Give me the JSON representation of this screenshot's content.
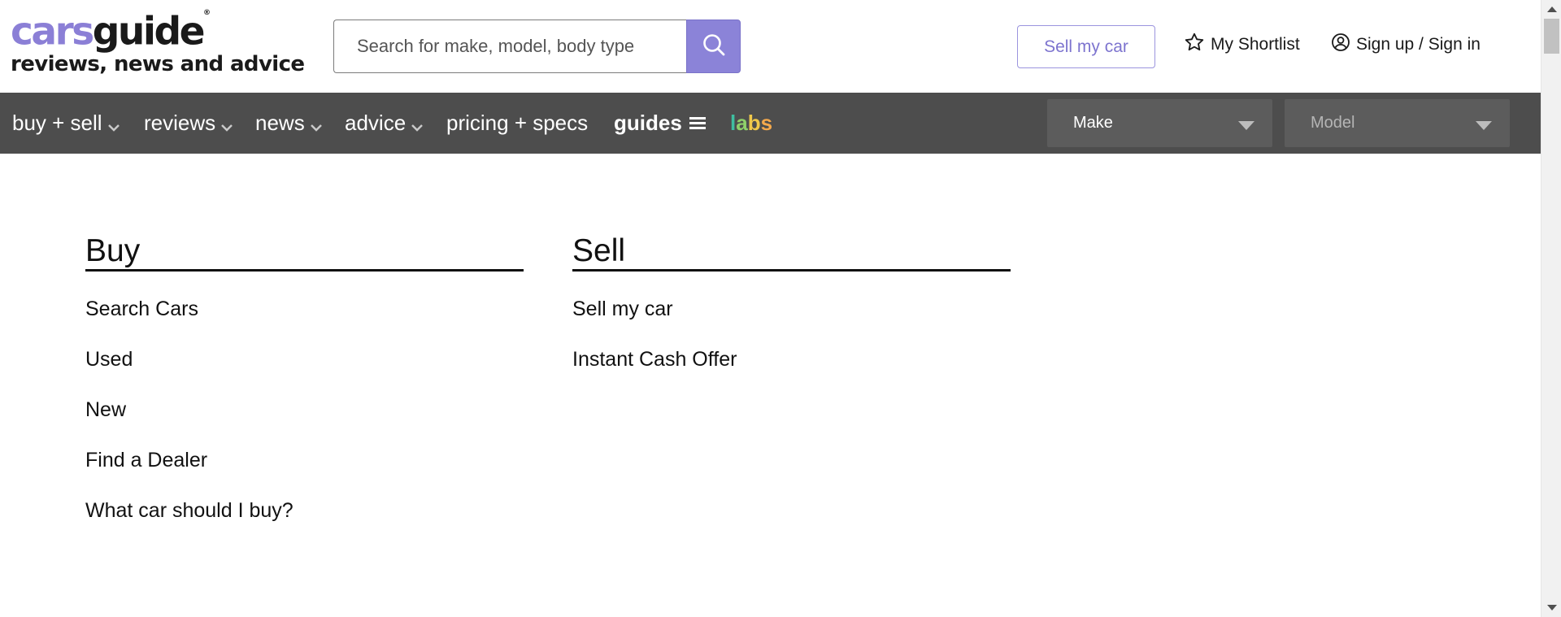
{
  "header": {
    "logo_cars": "cars",
    "logo_guide": "guide",
    "logo_reg": "®",
    "tagline": "reviews, news and advice",
    "search_placeholder": "Search for make, model, body type",
    "search_icon": "search-icon",
    "sell_button": "Sell my car",
    "shortlist": "My Shortlist",
    "shortlist_icon": "star-outline-icon",
    "signin": "Sign up / Sign in",
    "signin_icon": "user-circle-icon"
  },
  "nav": {
    "items": [
      {
        "label": "buy + sell",
        "has_dropdown": true
      },
      {
        "label": "reviews",
        "has_dropdown": true
      },
      {
        "label": "news",
        "has_dropdown": true
      },
      {
        "label": "advice",
        "has_dropdown": true
      },
      {
        "label": "pricing + specs",
        "has_dropdown": false
      },
      {
        "label": "guides",
        "icon": "hamburger-menu-icon"
      }
    ],
    "labs": {
      "l": "l",
      "a": "a",
      "b": "b",
      "s": "s"
    },
    "make_select": "Make",
    "model_select": "Model"
  },
  "menu": {
    "buy": {
      "title": "Buy",
      "links": [
        "Search Cars",
        "Used",
        "New",
        "Find a Dealer",
        "What car should I buy?"
      ]
    },
    "sell": {
      "title": "Sell",
      "links": [
        "Sell my car",
        "Instant Cash Offer"
      ]
    }
  },
  "colors": {
    "brand_purple": "#8b7fd6",
    "nav_background": "#4d4d4d",
    "select_background": "#5c5c5c",
    "labs_teal": "#3fbfa0",
    "labs_green": "#8fd06a",
    "labs_yellow": "#f0c84a"
  }
}
